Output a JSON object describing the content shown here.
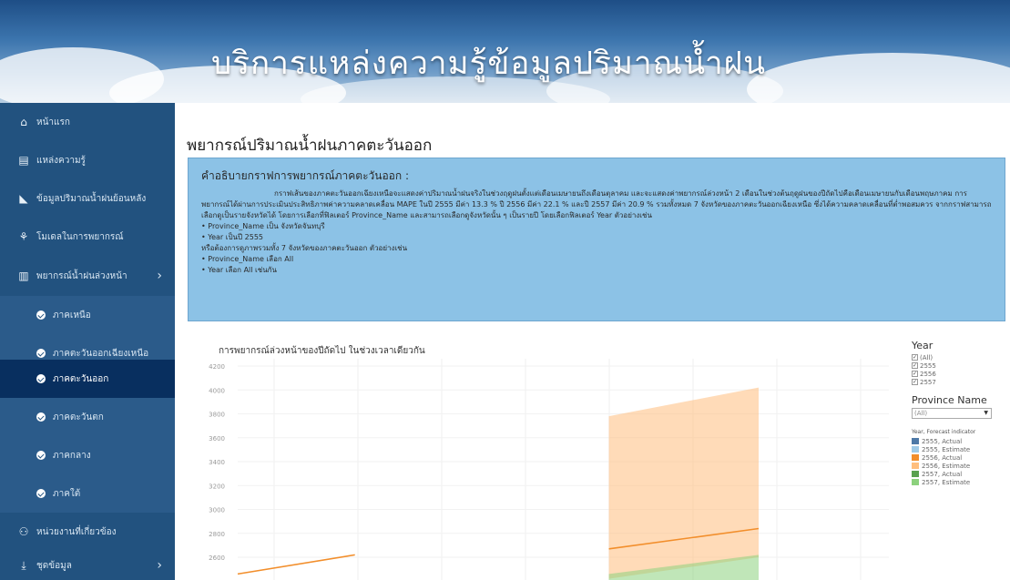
{
  "header": {
    "title": "บริการแหล่งความรู้ข้อมูลปริมาณน้ำฝน"
  },
  "sidebar": {
    "items": [
      {
        "label": "หน้าแรก",
        "icon": "home-icon"
      },
      {
        "label": "แหล่งความรู้",
        "icon": "book-icon"
      },
      {
        "label": "ข้อมูลปริมาณน้ำฝนย้อนหลัง",
        "icon": "chart-icon"
      },
      {
        "label": "โมเดลในการพยากรณ์",
        "icon": "sitemap-icon"
      },
      {
        "label": "พยากรณ์น้ำฝนล่วงหน้า",
        "icon": "bar-chart-icon"
      },
      {
        "label": "หน่วยงานที่เกี่ยวข้อง",
        "icon": "people-icon"
      },
      {
        "label": "ชุดข้อมูล",
        "icon": "download-icon"
      }
    ],
    "sub_items": [
      {
        "label": "ภาคเหนือ"
      },
      {
        "label": "ภาคตะวันออกเฉียงเหนือ"
      },
      {
        "label": "ภาคตะวันออก"
      },
      {
        "label": "ภาคตะวันตก"
      },
      {
        "label": "ภาคกลาง"
      },
      {
        "label": "ภาคใต้"
      }
    ],
    "active_sub": "ภาคตะวันออก"
  },
  "main": {
    "title": "พยากรณ์ปริมาณน้ำฝนภาคตะวันออก",
    "description": {
      "heading": "คำอธิบายกราฟการพยากรณ์ภาคตะวันออก :",
      "paragraph": "กราฟเส้นของภาคตะวันออกเฉียงเหนือจะแสดงค่าปริมาณน้ำฝนจริงในช่วงฤดูฝนตั้งแต่เดือนเมษายนถึงเดือนตุลาคม และจะแสดงค่าพยากรณ์ล่วงหน้า 2 เดือนในช่วงต้นฤดูฝนของปีถัดไปคือเดือนเมษายนกับเดือนพฤษภาคม การพยากรณ์ได้ผ่านการประเมินประสิทธิภาพค่าความคลาดเคลื่อน MAPE ในปี 2555 มีค่า 13.3 % ปี 2556 มีค่า 22.1 % และปี 2557 มีค่า 20.9 % รวมทั้งหมด 7 จังหวัดของภาคตะวันออกเฉียงเหนือ ซึ่งได้ความคลาดเคลื่อนที่ต่ำพอสมควร จากกราฟสามารถเลือกดูเป็นรายจังหวัดได้ โดยการเลือกที่ฟิลเตอร์ Province_Name และสามารถเลือกดูจังหวัดนั้น ๆ เป็นรายปี โดยเลือกฟิลเตอร์ Year ตัวอย่างเช่น",
      "lines": [
        "• Province_Name เป็น จังหวัดจันทบุรี",
        "• Year เป็นปี 2555",
        "หรือต้องการดูภาพรวมทั้ง 7 จังหวัดของภาคตะวันออก ตัวอย่างเช่น",
        "• Province_Name เลือก All",
        "• Year เลือก All เช่นกัน"
      ]
    }
  },
  "filters": {
    "year_title": "Year",
    "year_options": [
      "(All)",
      "2555",
      "2556",
      "2557"
    ],
    "province_title": "Province Name",
    "province_value": "(All)",
    "indicator_title": "Year, Forecast indicator",
    "indicator_items": [
      {
        "label": "2555, Actual",
        "color": "#4e79a7"
      },
      {
        "label": "2555, Estimate",
        "color": "#a0cbe8"
      },
      {
        "label": "2556, Actual",
        "color": "#f28e2b"
      },
      {
        "label": "2556, Estimate",
        "color": "#ffbe7d"
      },
      {
        "label": "2557, Actual",
        "color": "#59a14f"
      },
      {
        "label": "2557, Estimate",
        "color": "#8cd17d"
      }
    ]
  },
  "chart_data": {
    "type": "line",
    "title": "การพยากรณ์ล่วงหน้าของปีถัดไป ในช่วงเวลาเดียวกัน",
    "y_ticks": [
      4200,
      4000,
      3800,
      3600,
      3400,
      3200,
      3000,
      2800,
      2600
    ],
    "series": [
      {
        "name": "2556, Actual",
        "color": "#f28e2b",
        "points": [
          [
            0.0,
            2460
          ],
          [
            0.18,
            2620
          ]
        ]
      },
      {
        "name": "2556, Actual",
        "color": "#f28e2b",
        "points": [
          [
            0.57,
            2670
          ],
          [
            0.8,
            2840
          ]
        ]
      }
    ],
    "bands": [
      {
        "name": "2556, Estimate",
        "color": "#ffbe7d",
        "upper": [
          [
            0.57,
            3780
          ],
          [
            0.8,
            4020
          ]
        ],
        "lower": [
          [
            0.57,
            2420
          ],
          [
            0.8,
            2600
          ]
        ]
      },
      {
        "name": "2557, Estimate",
        "color": "#8cd17d",
        "upper": [
          [
            0.57,
            2460
          ],
          [
            0.8,
            2620
          ]
        ],
        "lower": [
          [
            0.57,
            2400
          ],
          [
            0.8,
            2400
          ]
        ]
      }
    ]
  }
}
